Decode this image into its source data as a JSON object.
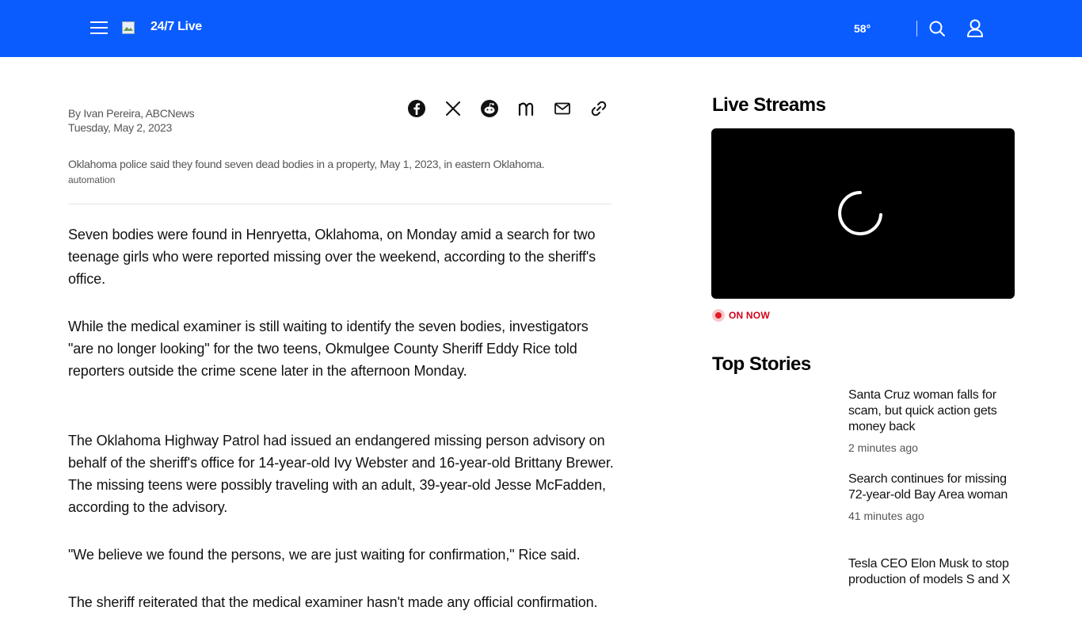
{
  "header": {
    "brand": "24/7 Live",
    "weather": "58°",
    "icons": [
      "hamburger-menu-icon",
      "logo-image",
      "search-icon",
      "user-icon"
    ],
    "colors": {
      "background": "#0a5cff",
      "text": "#ffffff"
    }
  },
  "article": {
    "byline": "By Ivan Pereira, ABCNews",
    "date": "Tuesday, May 2, 2023",
    "share_icons": [
      "facebook-icon",
      "x-icon",
      "reddit-icon",
      "newsbreak-icon",
      "email-icon",
      "link-icon"
    ],
    "caption": "Oklahoma police said they found seven dead bodies in a property, May 1, 2023, in eastern Oklahoma.",
    "credit": "automation",
    "paragraphs": [
      "Seven bodies were found in Henryetta, Oklahoma, on Monday amid a search for two teenage girls who were reported missing over the weekend, according to the sheriff's office.",
      "While the medical examiner is still waiting to identify the seven bodies, investigators \"are no longer looking\" for the two teens, Okmulgee County Sheriff Eddy Rice told reporters outside the crime scene later in the afternoon Monday.",
      "The Oklahoma Highway Patrol had issued an endangered missing person advisory on behalf of the sheriff's office for 14-year-old Ivy Webster and 16-year-old Brittany Brewer. The missing teens were possibly traveling with an adult, 39-year-old Jesse McFadden, according to the advisory.",
      "\"We believe we found the persons, we are just waiting for confirmation,\" Rice said.",
      "The sheriff reiterated that the medical examiner hasn't made any official confirmation."
    ]
  },
  "sidebar": {
    "live_streams": {
      "title": "Live Streams",
      "status": "ON NOW",
      "status_color": "#d0021b"
    },
    "top_stories": {
      "title": "Top Stories",
      "items": [
        {
          "title": "Santa Cruz woman falls for scam, but quick action gets money back",
          "time": "2 minutes ago"
        },
        {
          "title": "Search continues for missing 72-year-old Bay Area woman",
          "time": "41 minutes ago"
        },
        {
          "title": "Tesla CEO Elon Musk to stop production of models S and X",
          "time": ""
        }
      ]
    }
  }
}
